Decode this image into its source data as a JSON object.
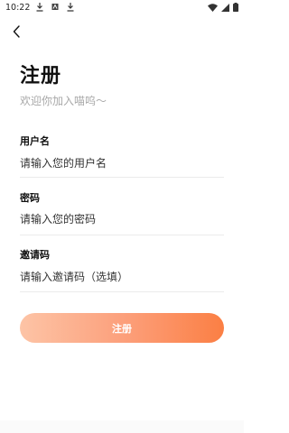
{
  "status_bar": {
    "time": "10:22",
    "icons": [
      "download-icon",
      "app-notification-icon",
      "download-icon",
      "wifi-icon",
      "signal-icon",
      "battery-icon"
    ]
  },
  "header": {
    "back_icon": "chevron-left-icon"
  },
  "page": {
    "title": "注册",
    "subtitle": "欢迎你加入喵呜～"
  },
  "form": {
    "username": {
      "label": "用户名",
      "placeholder": "请输入您的用户名"
    },
    "password": {
      "label": "密码",
      "placeholder": "请输入您的密码"
    },
    "invite": {
      "label": "邀请码",
      "placeholder": "请输入邀请码（选填）"
    },
    "submit_label": "注册"
  },
  "colors": {
    "button_gradient_start": "#fdc4a6",
    "button_gradient_end": "#fb7f44",
    "subtitle_gray": "#a9a9a9"
  }
}
